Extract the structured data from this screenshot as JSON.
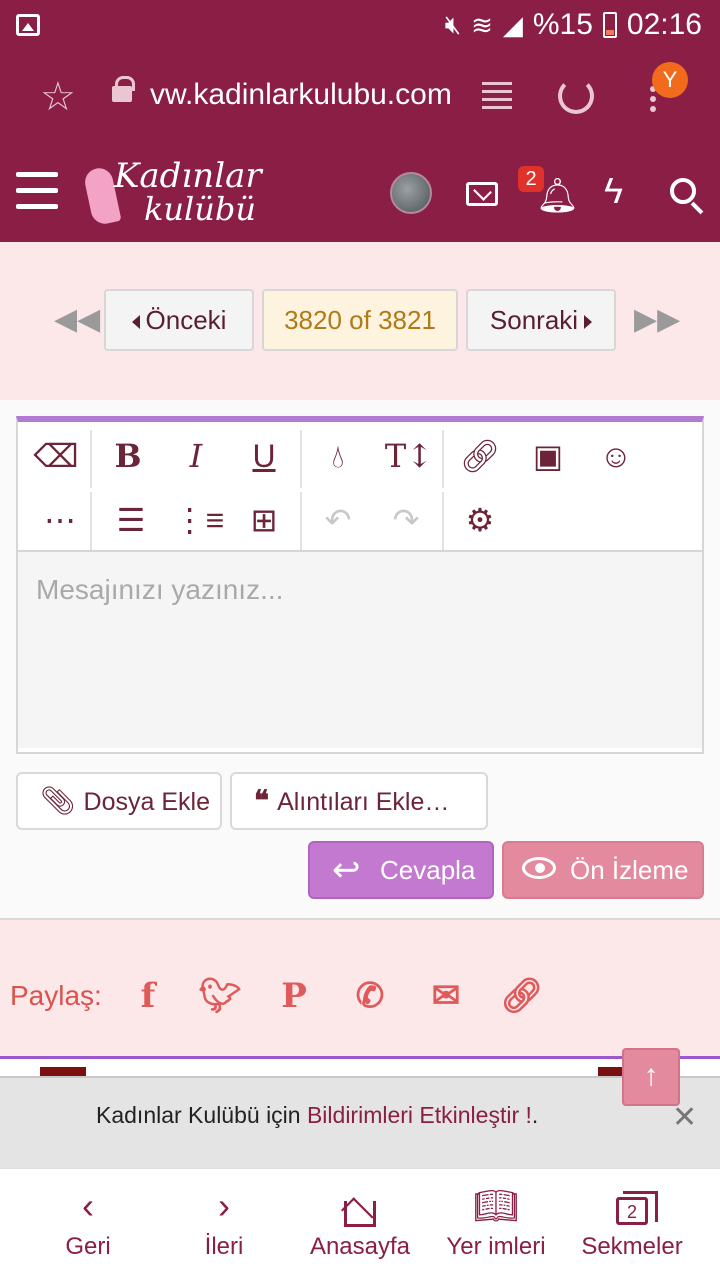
{
  "status_bar": {
    "battery_pct": "%15",
    "time": "02:16"
  },
  "browser": {
    "url": "vw.kadinlarkulubu.com",
    "profile_initial": "Y"
  },
  "site": {
    "logo_line1": "Kadınlar",
    "logo_line2": "kulübü",
    "notification_count": "2"
  },
  "pager": {
    "prev_label": "Önceki",
    "count": "3820 of 3821",
    "next_label": "Sonraki"
  },
  "editor": {
    "placeholder": "Mesajınızı yazınız...",
    "bold_glyph": "B",
    "italic_glyph": "I",
    "underline_glyph": "U",
    "textsize_glyph": "T↕",
    "more_glyph": "⋯"
  },
  "actions": {
    "attach_label": "Dosya Ekle",
    "quotes_label": "Alıntıları Ekle…",
    "reply_label": "Cevapla",
    "preview_label": "Ön İzleme"
  },
  "share": {
    "label": "Paylaş:"
  },
  "notification_banner": {
    "text_before": "Kadınlar Kulübü için ",
    "link": "Bildirimleri Etkinleştir !",
    "text_after": "."
  },
  "bottom_nav": {
    "back": "Geri",
    "forward": "İleri",
    "home": "Anasayfa",
    "bookmarks": "Yer imleri",
    "tabs": "Sekmeler",
    "tab_count": "2"
  },
  "colors": {
    "brand": "#8b1e45",
    "editor_accent": "#b37ad1",
    "reply_button": "#c379cf",
    "preview_button": "#e38a9e",
    "share_icons": "#e05a5a"
  }
}
